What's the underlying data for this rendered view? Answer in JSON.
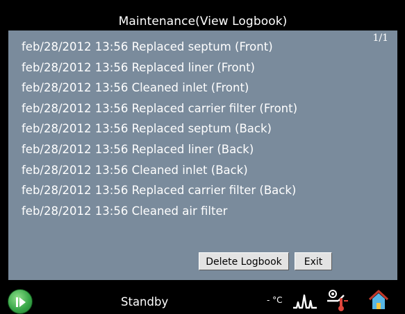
{
  "header": {
    "title": "Maintenance(View Logbook)"
  },
  "logbook": {
    "page_indicator": "1/1",
    "entries": [
      "feb/28/2012 13:56 Replaced septum (Front)",
      "feb/28/2012 13:56 Replaced liner (Front)",
      "feb/28/2012 13:56 Cleaned inlet (Front)",
      "feb/28/2012 13:56 Replaced carrier filter (Front)",
      "feb/28/2012 13:56 Replaced septum (Back)",
      "feb/28/2012 13:56 Replaced liner (Back)",
      "feb/28/2012 13:56 Cleaned inlet (Back)",
      "feb/28/2012 13:56 Replaced carrier filter (Back)",
      "feb/28/2012 13:56 Cleaned air filter"
    ],
    "delete_label": "Delete Logbook",
    "exit_label": "Exit"
  },
  "status_bar": {
    "status": "Standby",
    "temperature": "- °C",
    "icons": [
      "run-icon",
      "chromatogram-icon",
      "temperature-icon",
      "home-icon"
    ]
  },
  "colors": {
    "background": "#000000",
    "panel": "#7a8b9c",
    "text": "#ffffff",
    "button": "#e3e3e3",
    "run_green": "#3aa84a",
    "home_blue": "#57b7e6",
    "home_roof": "#c0392b"
  }
}
